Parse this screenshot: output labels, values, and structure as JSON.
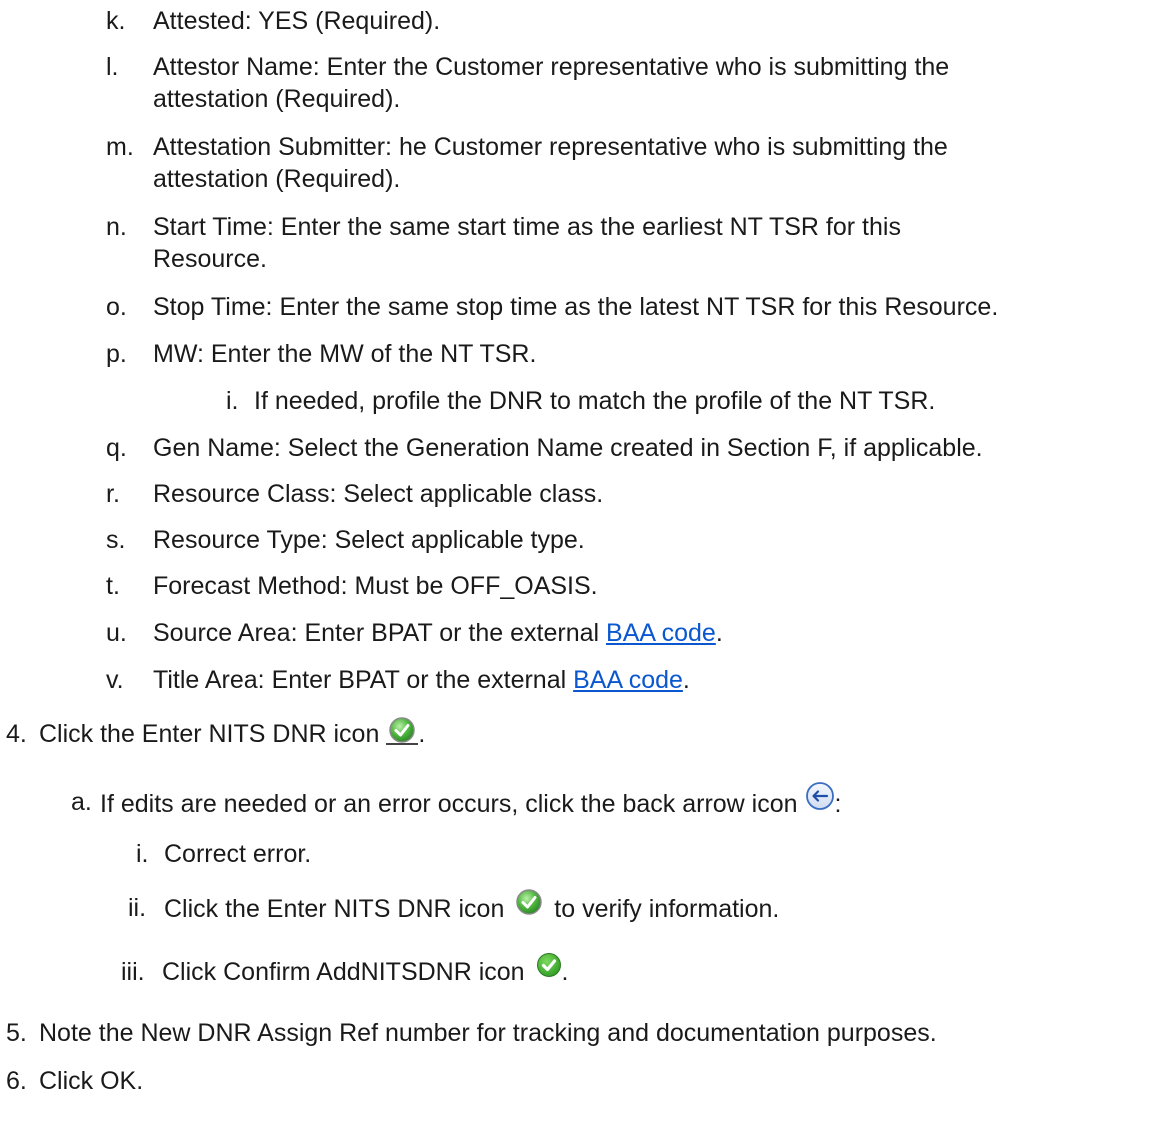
{
  "sub_items": [
    {
      "letter": "k.",
      "text": "Attested:  YES (Required)."
    },
    {
      "letter": "l.",
      "text": "Attestor Name:  Enter the Customer representative who is submitting the",
      "cont": "attestation (Required)."
    },
    {
      "letter": "m.",
      "text": "Attestation Submitter:  he Customer representative who is submitting the",
      "cont": "attestation (Required)."
    },
    {
      "letter": "n.",
      "text": "Start Time:  Enter the same start time as the earliest NT TSR for this",
      "cont": "Resource."
    },
    {
      "letter": "o.",
      "text": "Stop Time:  Enter the same stop time as the latest NT TSR for this Resource."
    },
    {
      "letter": "p.",
      "text": "MW:  Enter the MW of the NT TSR."
    },
    {
      "letter": "q.",
      "text": "Gen Name:  Select the Generation Name created in Section F, if applicable."
    },
    {
      "letter": "r.",
      "text": "Resource Class:  Select applicable class."
    },
    {
      "letter": "s.",
      "text": "Resource Type:  Select applicable type."
    },
    {
      "letter": "t.",
      "text": "Forecast Method:  Must be OFF_OASIS."
    },
    {
      "letter": "u.",
      "text_before": "Source Area:  Enter BPAT or the external ",
      "link": "BAA code",
      "text_after": "."
    },
    {
      "letter": "v.",
      "text_before": "Title Area:  Enter BPAT or the external ",
      "link": "BAA code",
      "text_after": "."
    }
  ],
  "p_sub": {
    "roman": "i.",
    "text": "If needed, profile the DNR to match the profile of the NT TSR."
  },
  "step4": {
    "num": "4.",
    "text": "Click the Enter NITS DNR icon",
    "after": "."
  },
  "step4a": {
    "letter": "a.",
    "text": "If edits are needed or an error occurs, click the back arrow icon",
    "after": ":"
  },
  "step4a_subs": [
    {
      "roman": "i.",
      "text": "Correct error."
    },
    {
      "roman": "ii.",
      "text_before": "Click the Enter NITS DNR icon",
      "text_after": "to verify information."
    },
    {
      "roman": "iii.",
      "text_before": "Click Confirm AddNITSDNR icon",
      "text_after": "."
    }
  ],
  "step5": {
    "num": "5.",
    "text": "Note the New DNR Assign Ref number for tracking and documentation purposes."
  },
  "step6": {
    "num": "6.",
    "text": "Click OK."
  },
  "icons": {
    "enter_nits_dnr": "green-check-circle-icon",
    "back_arrow": "back-arrow-icon",
    "confirm": "green-check-shield-icon"
  },
  "colors": {
    "link": "#0b57d0",
    "icon_green": "#3daa3a"
  }
}
